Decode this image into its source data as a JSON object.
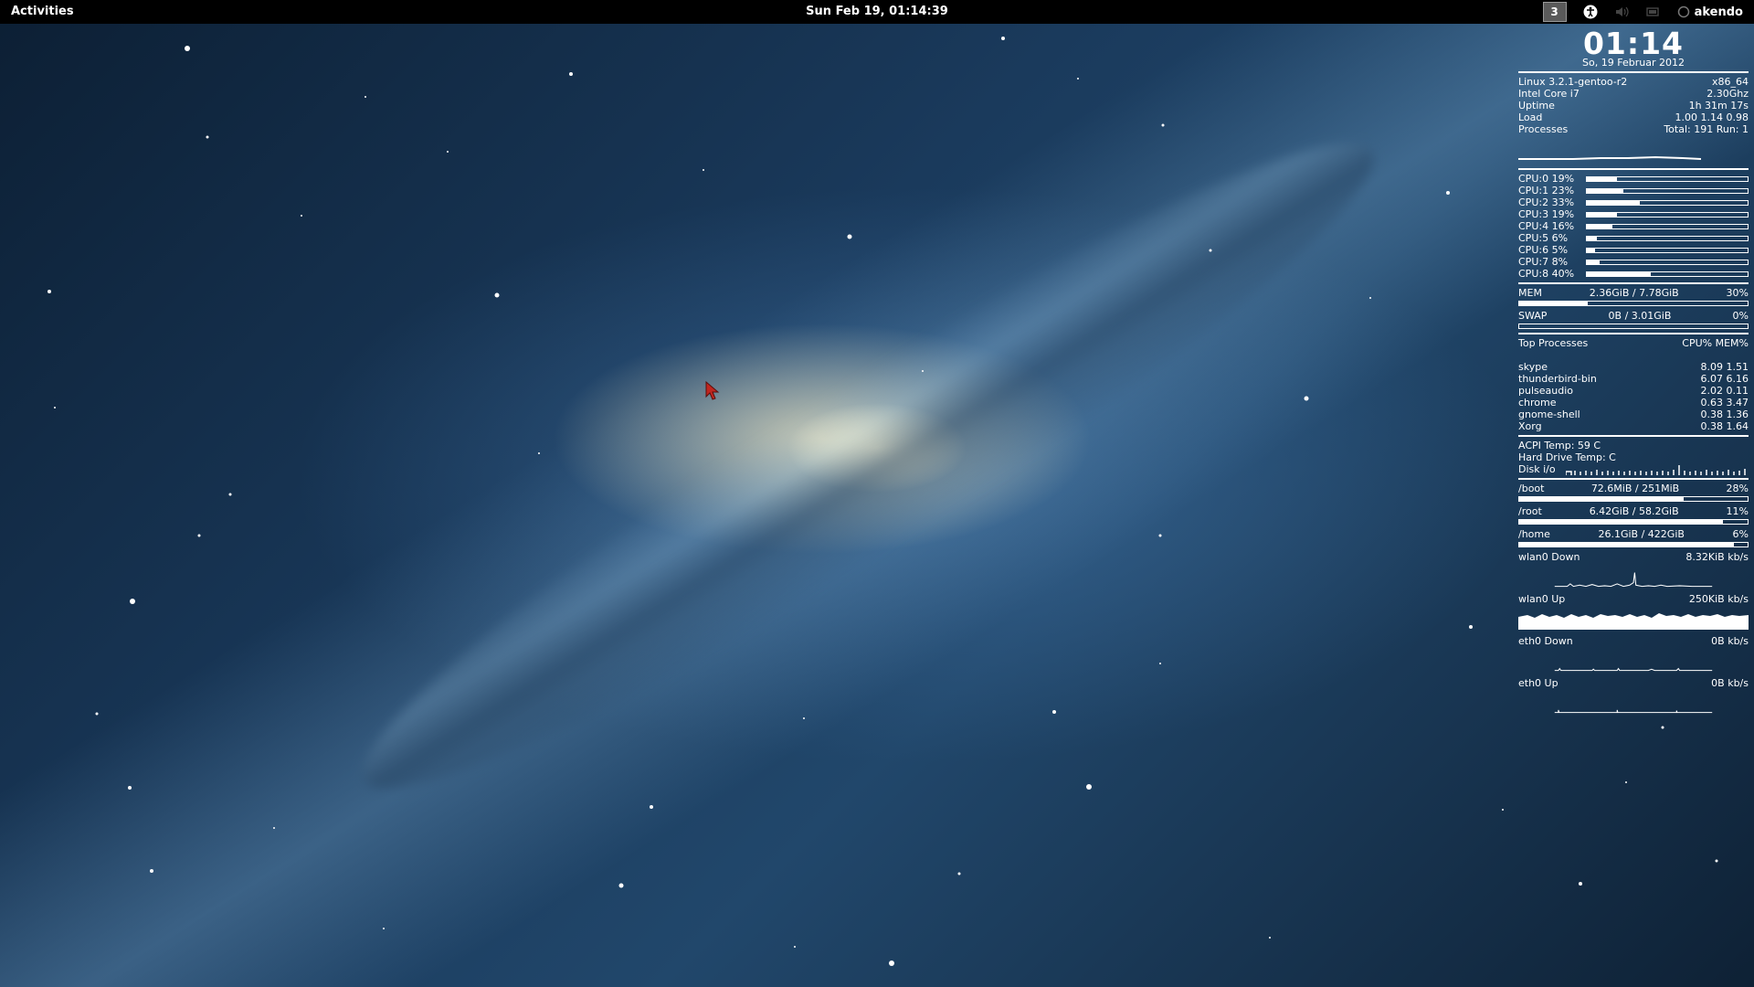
{
  "topbar": {
    "activities": "Activities",
    "datetime": "Sun Feb 19, 01:14:39",
    "workspace": "3",
    "accessibility_icon": "accessibility-icon",
    "volume_icon": "volume-icon",
    "network_icon": "network-icon",
    "user_icon": "user-status-icon",
    "username": "akendo"
  },
  "conky": {
    "time": "01:14",
    "date": "So, 19 Februar 2012",
    "sysinfo": [
      {
        "label": "Linux 3.2.1-gentoo-r2",
        "value": "x86_64"
      },
      {
        "label": "Intel Core i7",
        "value": "2.30Ghz"
      },
      {
        "label": "Uptime",
        "value": "1h 31m 17s"
      },
      {
        "label": "Load",
        "value": "1.00 1.14 0.98"
      },
      {
        "label": "Processes",
        "value": "Total: 191   Run: 1"
      }
    ],
    "cpus": [
      {
        "label": "CPU:0  19%",
        "percent": 19
      },
      {
        "label": "CPU:1  23%",
        "percent": 23
      },
      {
        "label": "CPU:2  33%",
        "percent": 33
      },
      {
        "label": "CPU:3  19%",
        "percent": 19
      },
      {
        "label": "CPU:4  16%",
        "percent": 16
      },
      {
        "label": "CPU:5  6%",
        "percent": 6
      },
      {
        "label": "CPU:6  5%",
        "percent": 5
      },
      {
        "label": "CPU:7  8%",
        "percent": 8
      },
      {
        "label": "CPU:8  40%",
        "percent": 40
      }
    ],
    "mem": {
      "label": "MEM",
      "value": "2.36GiB / 7.78GiB",
      "pct": "30%",
      "percent": 30
    },
    "swap": {
      "label": "SWAP",
      "value": "0B    / 3.01GiB",
      "pct": "0%",
      "percent": 0
    },
    "top": {
      "title": "Top Processes",
      "cols": "CPU% MEM%",
      "rows": [
        {
          "name": "skype",
          "vals": "8.09  1.51"
        },
        {
          "name": "thunderbird-bin",
          "vals": "6.07  6.16"
        },
        {
          "name": "pulseaudio",
          "vals": "2.02  0.11"
        },
        {
          "name": "chrome",
          "vals": "0.63  3.47"
        },
        {
          "name": "gnome-shell",
          "vals": "0.38  1.36"
        },
        {
          "name": "Xorg",
          "vals": "0.38  1.64"
        }
      ]
    },
    "acpi_temp": "ACPI Temp: 59 C",
    "hdd_temp": "Hard Drive Temp: C",
    "disk_io": "Disk i/o",
    "disks": [
      {
        "name": "/boot",
        "value": "72.6MiB / 251MiB",
        "pct": "28%",
        "percent": 28
      },
      {
        "name": "/root",
        "value": "6.42GiB / 58.2GiB",
        "pct": "11%",
        "percent": 11
      },
      {
        "name": "/home",
        "value": "26.1GiB / 422GiB",
        "pct": "6%",
        "percent": 6
      }
    ],
    "net": [
      {
        "label": "wlan0 Down",
        "value": "8.32KiB  kb/s"
      },
      {
        "label": "wlan0 Up",
        "value": "250KiB   kb/s"
      },
      {
        "label": "eth0 Down",
        "value": "0B     kb/s"
      },
      {
        "label": "eth0 Up",
        "value": "0B     kb/s"
      }
    ]
  }
}
